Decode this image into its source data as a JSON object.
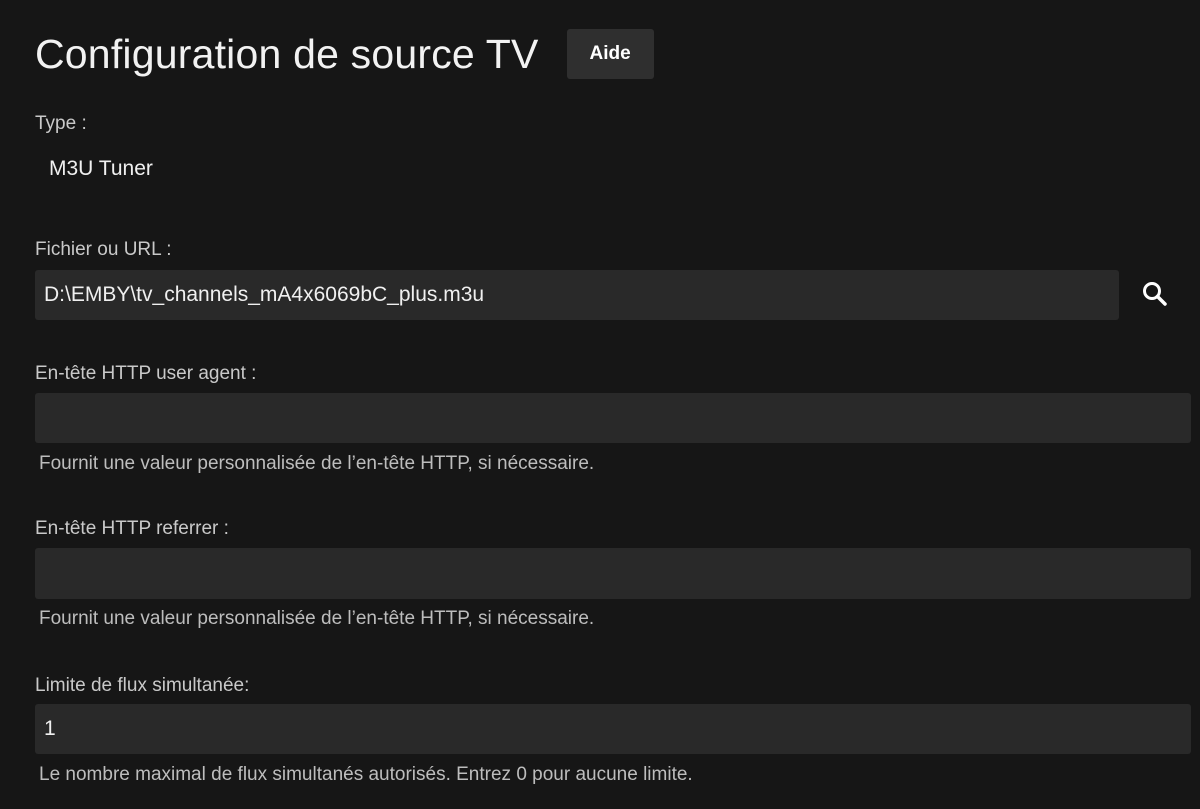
{
  "header": {
    "title": "Configuration de source TV",
    "help_label": "Aide"
  },
  "type_section": {
    "label": "Type :",
    "value": "M3U Tuner"
  },
  "file_section": {
    "label": "Fichier ou URL :",
    "value": "D:\\EMBY\\tv_channels_mA4x6069bC_plus.m3u",
    "search_icon": "search-icon"
  },
  "user_agent_section": {
    "label": "En-tête HTTP user agent :",
    "value": "",
    "help": "Fournit une valeur personnalisée de l’en-tête HTTP, si nécessaire."
  },
  "referrer_section": {
    "label": "En-tête HTTP referrer :",
    "value": "",
    "help": "Fournit une valeur personnalisée de l’en-tête HTTP, si nécessaire."
  },
  "stream_limit_section": {
    "label": "Limite de flux simultanée:",
    "value": "1",
    "help": "Le nombre maximal de flux simultanés autorisés. Entrez 0 pour aucune limite."
  },
  "colors": {
    "background": "#161616",
    "field_background": "#292929",
    "button_background": "#2f2f2f"
  }
}
